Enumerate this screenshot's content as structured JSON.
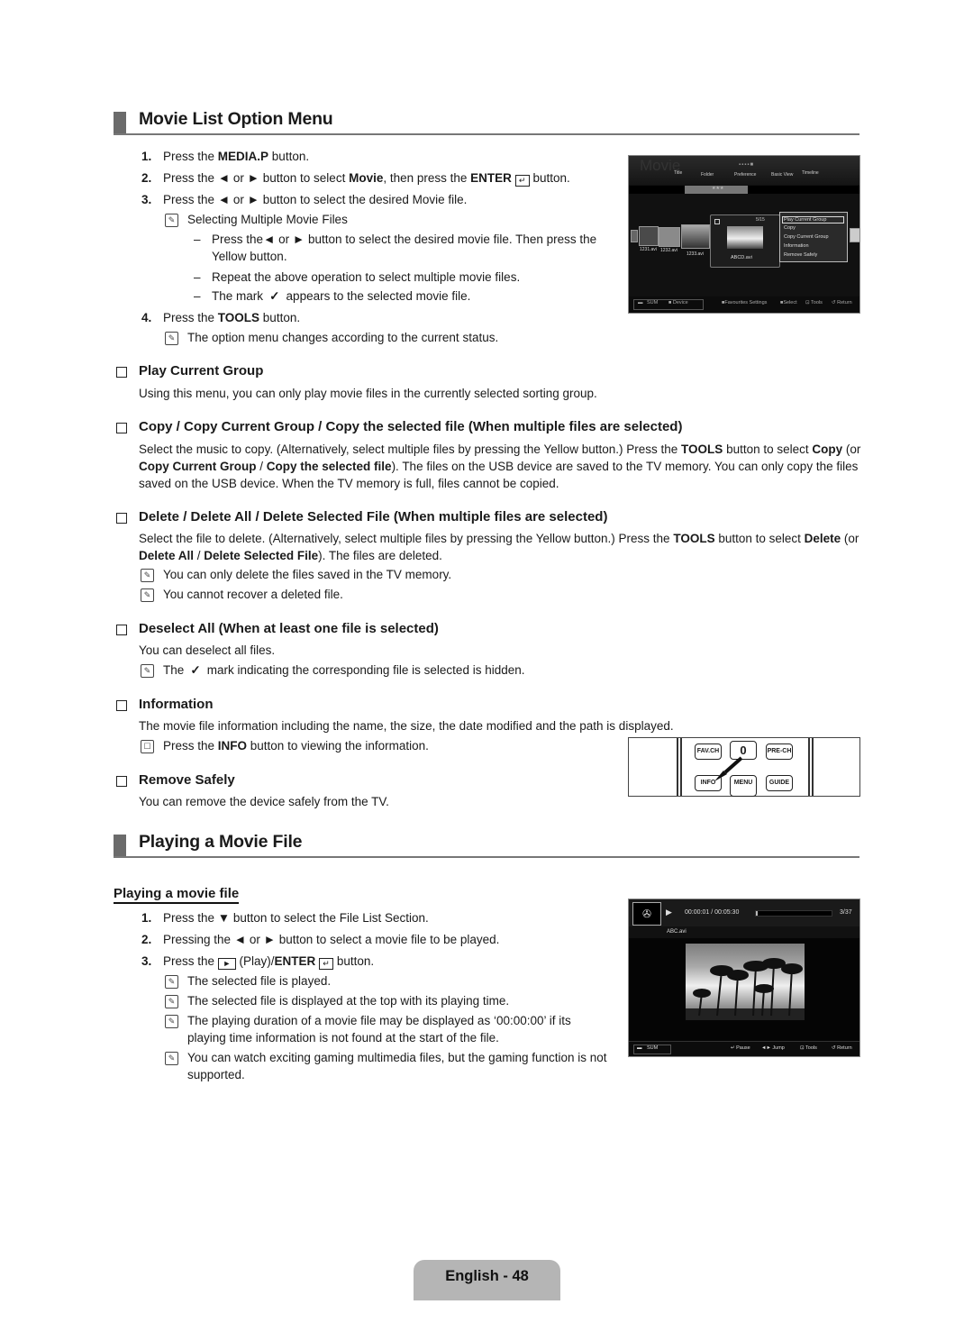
{
  "section1": {
    "title": "Movie List Option Menu",
    "steps": [
      {
        "num": "1.",
        "pre": "Press the ",
        "bold": "MEDIA.P",
        "post": " button."
      },
      {
        "num": "2.",
        "pre": "Press the ◄ or ► button to select ",
        "bold": "Movie",
        "mid": ", then press the ",
        "bold2": "ENTER",
        "post": " button."
      },
      {
        "num": "3.",
        "text": "Press the ◄ or ► button to select the desired Movie file."
      },
      {
        "num": "4.",
        "pre": "Press the ",
        "bold": "TOOLS",
        "post": " button."
      }
    ],
    "note_selecting": "Selecting Multiple Movie Files",
    "dashes": [
      "Press the◄ or ► button to select the desired movie file. Then press the",
      "Yellow button.",
      "Repeat the above operation to select multiple movie files.",
      "The mark",
      "appears to the selected movie file."
    ],
    "note_option": "The option menu changes according to the current status."
  },
  "tv_list_screen": {
    "brand": "Movie",
    "tabs": [
      "Title",
      "Folder",
      "Preference",
      "Basic View",
      "Timeline"
    ],
    "sort_stars": "★★★",
    "files": [
      "1231.avi",
      "1232.avi",
      "1233.avi"
    ],
    "selected_card": {
      "counter": "5/15",
      "name": "ABCD.avi"
    },
    "option_menu": [
      "Play Current Group",
      "Copy",
      "Copy Current Group",
      "Information",
      "Remove Safely"
    ],
    "selected_option": "Play Current Group",
    "footer": {
      "sum": "SUM",
      "device": "Device",
      "favourites": "Favourites Settings",
      "select": "Select",
      "tools": "Tools",
      "return": "Return"
    }
  },
  "options": [
    {
      "title": "Play Current Group",
      "body": "Using this menu, you can only play movie files in the currently selected sorting group."
    },
    {
      "title": "Copy / Copy Current Group / Copy the selected file (When multiple files are selected)",
      "body_parts": [
        "Select the music to copy. (Alternatively, select multiple files by pressing the Yellow button.) Press the ",
        "TOOLS",
        " button to select ",
        "Copy",
        " (or ",
        "Copy Current Group",
        " / ",
        "Copy the selected file",
        "). The files on the USB device are saved to the TV memory. You can only copy the files saved on the USB device. When the TV memory is full, files cannot be copied."
      ]
    },
    {
      "title": "Delete / Delete All / Delete Selected File (When multiple files are selected)",
      "body_parts": [
        "Select the file to delete. (Alternatively, select multiple files by pressing the Yellow button.) Press the ",
        "TOOLS",
        " button to select ",
        "Delete",
        " (or ",
        "Delete All",
        " / ",
        "Delete Selected File",
        "). The files are deleted."
      ],
      "notes": [
        "You can only delete the files saved in the TV memory.",
        "You cannot recover a deleted file."
      ]
    },
    {
      "title": "Deselect All (When at least one file is selected)",
      "body": "You can deselect all files.",
      "note_pre": "The",
      "note_post": "mark indicating the corresponding file is selected is hidden."
    },
    {
      "title": "Information",
      "body": "The movie file information including the name, the size, the date modified and the path is displayed.",
      "note_pre": "Press the ",
      "note_bold": "INFO",
      "note_post": " button to viewing the information."
    },
    {
      "title": "Remove Safely",
      "body": "You can remove the device safely from the TV."
    }
  ],
  "remote": {
    "keys": [
      "FAV.CH",
      "0",
      "PRE-CH",
      "INFO",
      "MENU",
      "GUIDE"
    ]
  },
  "section2": {
    "title": "Playing a Movie File",
    "subtitle": "Playing a movie file",
    "steps": [
      {
        "num": "1.",
        "text": "Press the ▼ button to select the File List Section."
      },
      {
        "num": "2.",
        "text": "Pressing the ◄ or ► button to select a movie file to be played."
      },
      {
        "num": "3.",
        "pre": "Press the ",
        "mid": " (Play)/",
        "bold": "ENTER",
        "post": " button."
      }
    ],
    "notes": [
      "The selected file is played.",
      "The selected file is displayed at the top with its playing time.",
      "The playing duration of a movie file may be displayed as ‘00:00:00’ if its",
      "playing time information is not found at the start of the file.",
      "You can watch exciting gaming multimedia files, but the gaming function is not",
      "supported."
    ]
  },
  "tv_play_screen": {
    "time": "00:00:01 / 00:05:30",
    "progress_fraction": 0.003,
    "counter": "3/37",
    "filename": "ABC.avi",
    "footer": {
      "sum": "SUM",
      "pause": "Pause",
      "jump": "Jump",
      "tools": "Tools",
      "return": "Return"
    }
  },
  "footer": {
    "page_label": "English - 48"
  }
}
